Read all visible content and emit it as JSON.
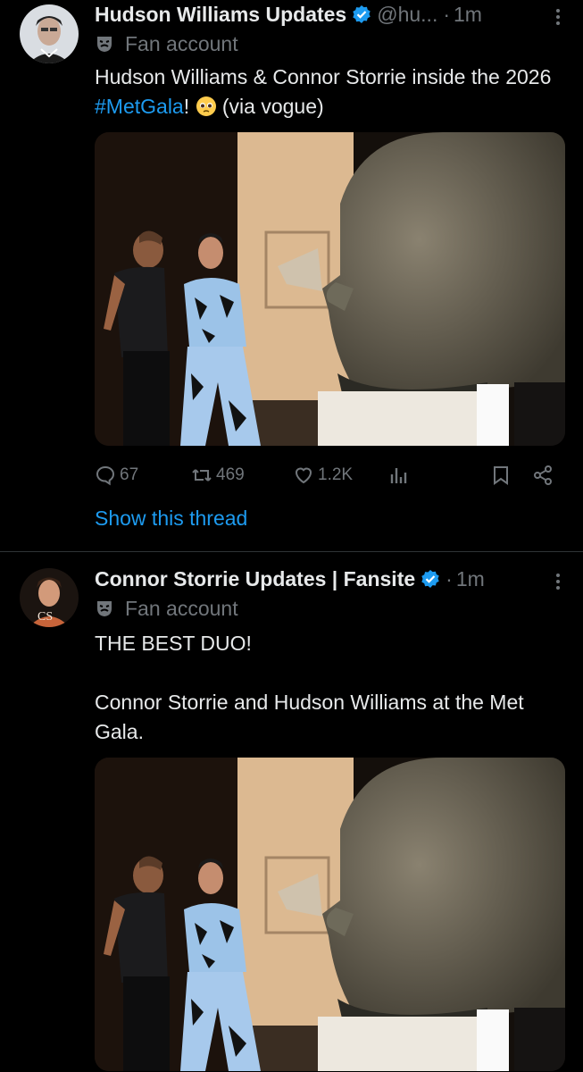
{
  "tweets": [
    {
      "name": "Hudson Williams Updates",
      "handle": "@hu...",
      "separator": "·",
      "time": "1m",
      "label": "Fan account",
      "text_before": "Hudson Williams & Connor Storrie inside the 2026 ",
      "hashtag": "#MetGala",
      "text_mid": "! ",
      "text_after": " (via vogue)",
      "emoji": "pleading-face",
      "replies": "67",
      "reposts": "469",
      "likes": "1.2K",
      "show_thread": "Show this thread"
    },
    {
      "name": "Connor Storrie Updates | Fansite",
      "separator": "·",
      "time": "1m",
      "label": "Fan account",
      "line1": "THE BEST DUO!",
      "line2": "Connor Storrie and Hudson Williams at the Met Gala."
    }
  ],
  "colors": {
    "accent": "#1d9bf0",
    "text": "#e7e9ea",
    "muted": "#71767b",
    "background": "#000000"
  },
  "icons": [
    "verified-badge-icon",
    "more-icon",
    "fan-account-mask-icon",
    "reply-icon",
    "repost-icon",
    "like-icon",
    "views-icon",
    "bookmark-icon",
    "share-icon"
  ]
}
